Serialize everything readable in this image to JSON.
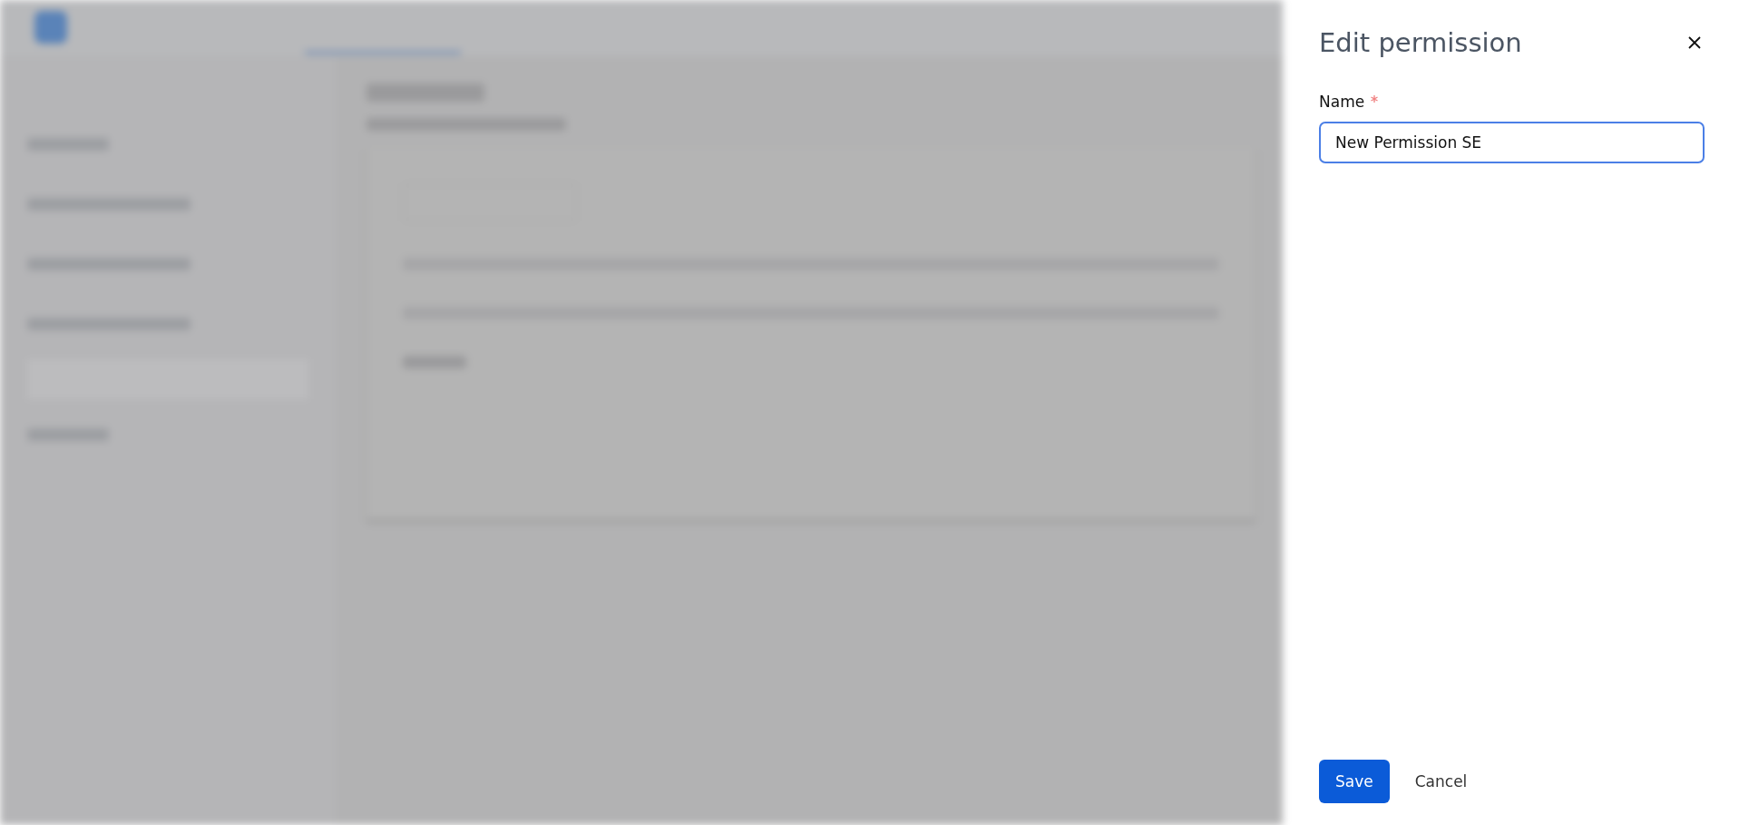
{
  "drawer": {
    "title": "Edit permission",
    "field": {
      "label": "Name",
      "required": true,
      "value": "New Permission SE"
    },
    "buttons": [
      {
        "label": "Save",
        "kind": "primary"
      },
      {
        "label": "Cancel",
        "kind": "link"
      }
    ]
  }
}
